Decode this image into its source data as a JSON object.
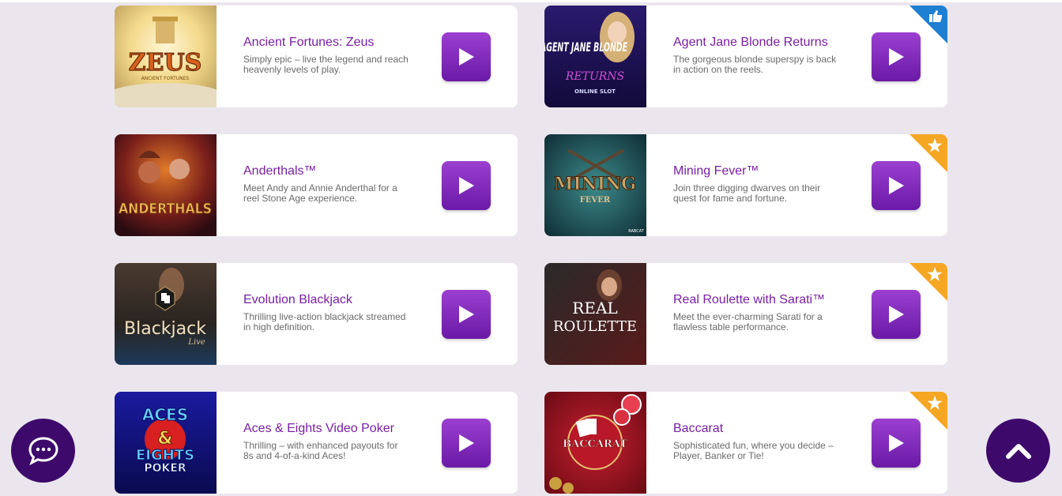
{
  "games": [
    {
      "title": "Ancient Fortunes: Zeus",
      "description": "Simply epic – live the legend and reach heavenly levels of play.",
      "thumb_icon": "zeus-thumbnail",
      "thumb_text": "ZEUS",
      "thumb_subtext": "ANCIENT FORTUNES",
      "badge": null
    },
    {
      "title": "Agent Jane Blonde Returns",
      "description": "The gorgeous blonde superspy is back in action on the reels.",
      "thumb_icon": "agent-jane-blonde-thumbnail",
      "thumb_text": "AGENT JANE BLONDE",
      "thumb_subtext": "RETURNS",
      "thumb_caption": "ONLINE SLOT",
      "badge": "thumbs-up"
    },
    {
      "title": "Anderthals™",
      "description": "Meet Andy and Annie Anderthal for a reel Stone Age experience.",
      "thumb_icon": "anderthals-thumbnail",
      "thumb_text": "ANDERTHALS",
      "badge": null
    },
    {
      "title": "Mining Fever™",
      "description": "Join three digging dwarves on their quest for fame and fortune.",
      "thumb_icon": "mining-fever-thumbnail",
      "thumb_text": "MINING",
      "thumb_subtext": "FEVER",
      "thumb_caption": "RABCAT",
      "badge": "star"
    },
    {
      "title": "Evolution Blackjack",
      "description": "Thrilling live-action blackjack streamed in high definition.",
      "thumb_icon": "blackjack-thumbnail",
      "thumb_text": "Blackjack",
      "thumb_subtext": "Live",
      "badge": null
    },
    {
      "title": "Real Roulette with Sarati™",
      "description": "Meet the ever-charming Sarati for a flawless table performance.",
      "thumb_icon": "real-roulette-thumbnail",
      "thumb_text": "REAL",
      "thumb_subtext": "ROULETTE",
      "badge": "star"
    },
    {
      "title": "Aces & Eights Video Poker",
      "description": "Thrilling – with enhanced payouts for 8s and 4-of-a-kind Aces!",
      "thumb_icon": "aces-eights-thumbnail",
      "thumb_text": "ACES",
      "thumb_amp": "&",
      "thumb_subtext": "EIGHTS",
      "thumb_caption": "POKER",
      "badge": null
    },
    {
      "title": "Baccarat",
      "description": "Sophisticated fun, where you decide – Player, Banker or Tie!",
      "thumb_icon": "baccarat-thumbnail",
      "thumb_text": "BACCARAT",
      "badge": "star"
    }
  ],
  "colors": {
    "background": "#ebe6ee",
    "title": "#7a1fa2",
    "play_button": "#7b2cbf",
    "badge_star": "#f5a623",
    "badge_thumb": "#1f7fd1",
    "floating_button": "#3d0a6b"
  },
  "icons": {
    "play": "play-icon",
    "chat": "chat-bubble-icon",
    "scroll_top": "chevron-up-icon",
    "star": "star-icon",
    "thumbs_up": "thumbs-up-icon"
  }
}
